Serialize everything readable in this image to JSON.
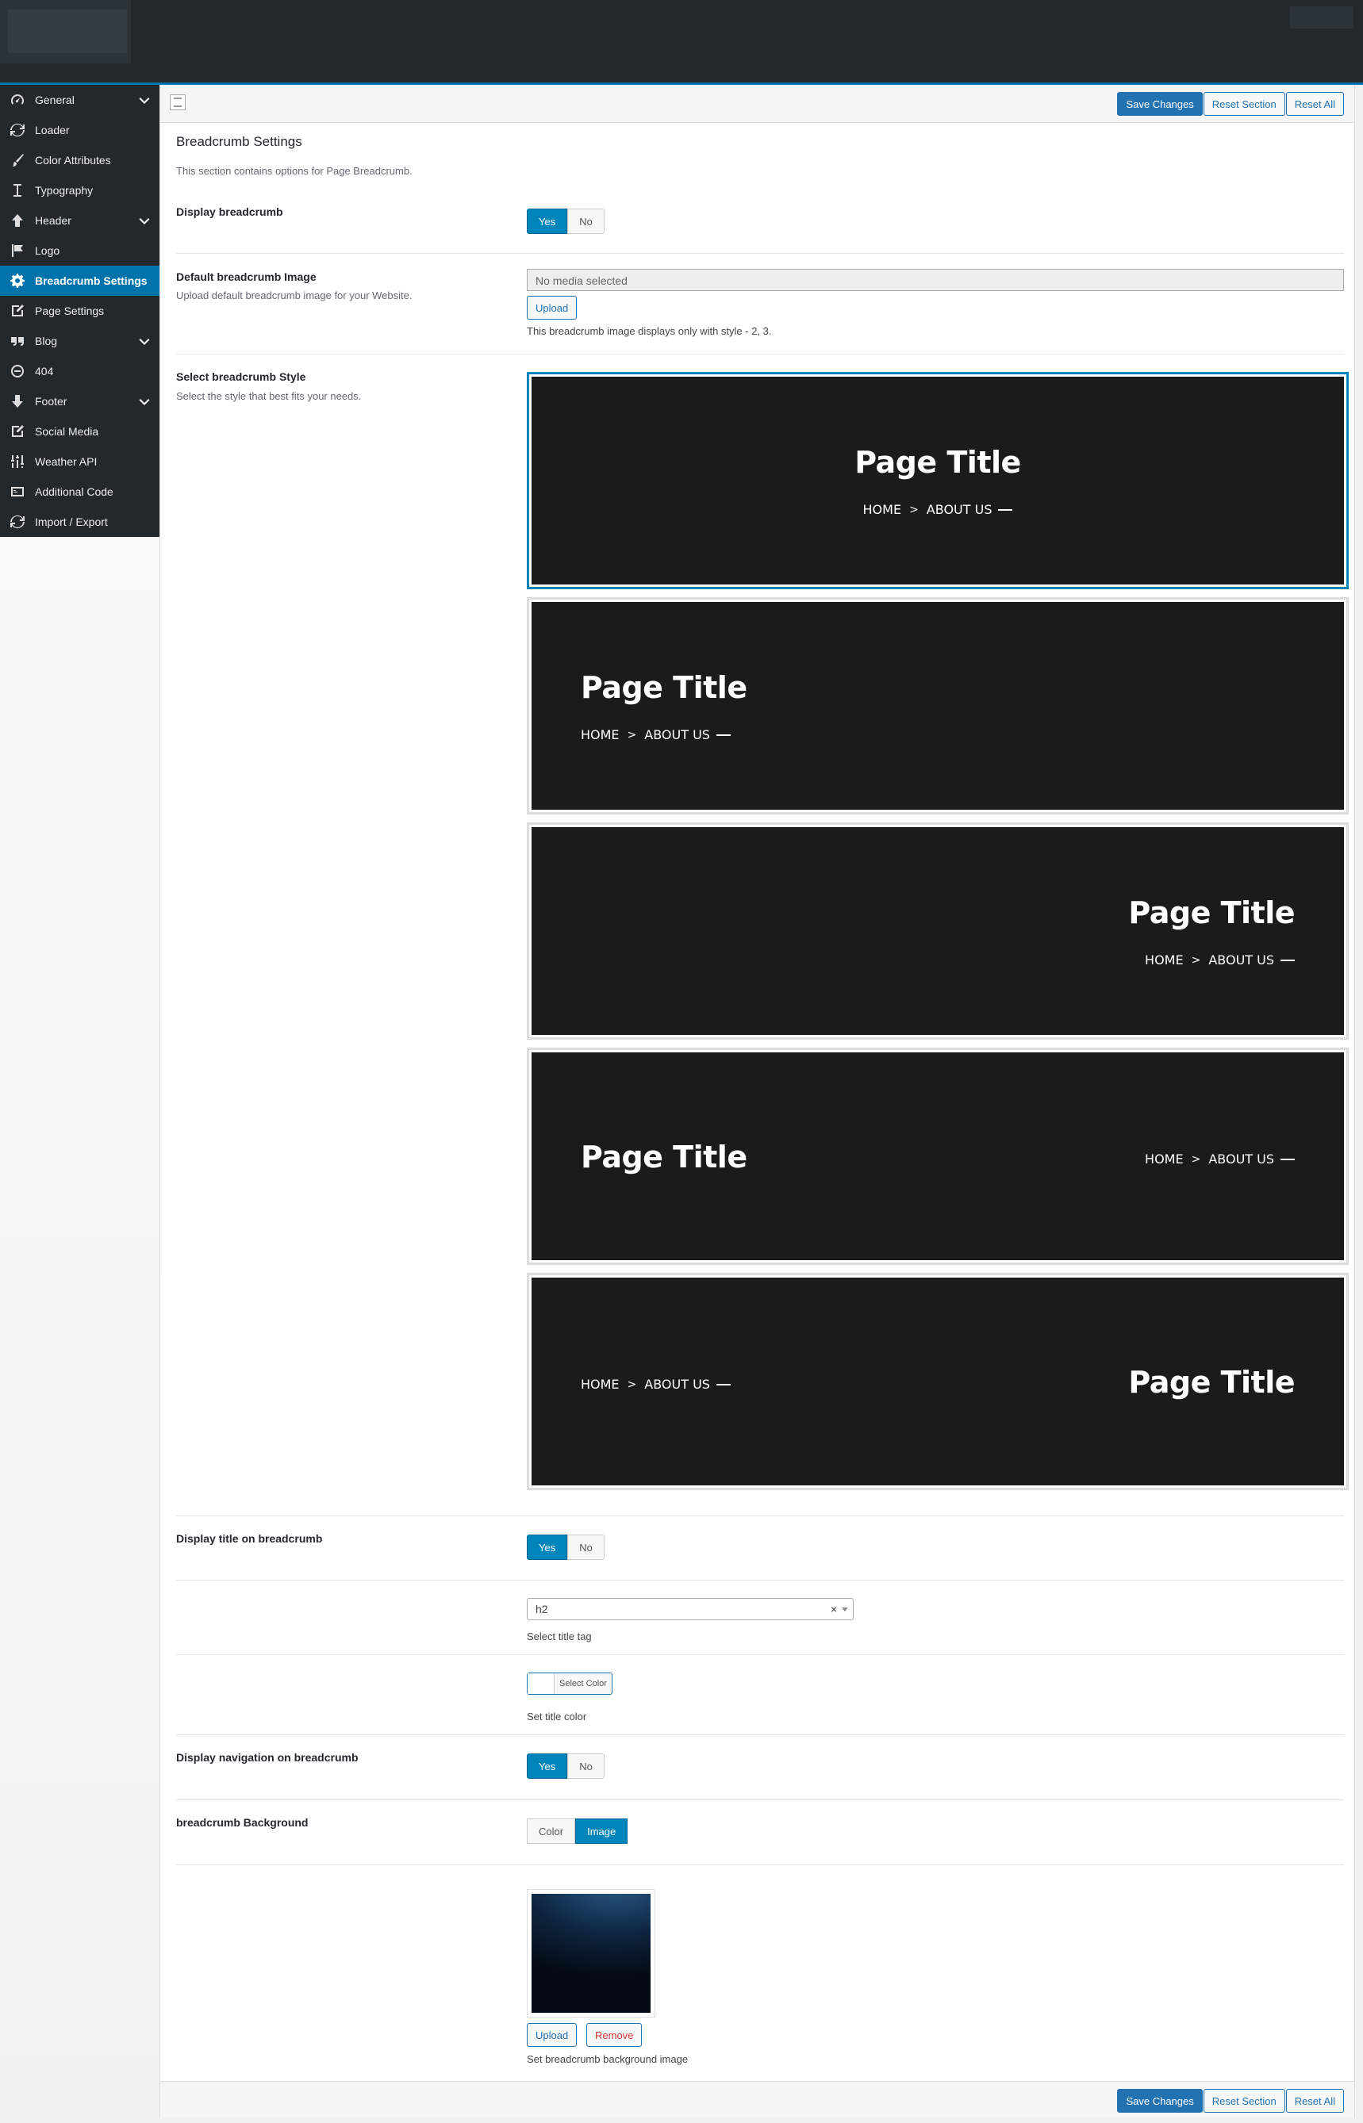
{
  "sidebar": {
    "items": [
      {
        "label": "General",
        "icon": "dashboard-gauge-icon",
        "has_children": true
      },
      {
        "label": "Loader",
        "icon": "refresh-icon",
        "has_children": false
      },
      {
        "label": "Color Attributes",
        "icon": "brush-icon",
        "has_children": false
      },
      {
        "label": "Typography",
        "icon": "text-cursor-icon",
        "has_children": false
      },
      {
        "label": "Header",
        "icon": "arrow-up-icon",
        "has_children": true
      },
      {
        "label": "Logo",
        "icon": "flag-icon",
        "has_children": false
      },
      {
        "label": "Breadcrumb Settings",
        "icon": "gear-icon",
        "has_children": false,
        "active": true
      },
      {
        "label": "Page Settings",
        "icon": "edit-icon",
        "has_children": false
      },
      {
        "label": "Blog",
        "icon": "quote-icon",
        "has_children": true
      },
      {
        "label": "404",
        "icon": "minus-circle-icon",
        "has_children": false
      },
      {
        "label": "Footer",
        "icon": "arrow-down-icon",
        "has_children": true
      },
      {
        "label": "Social Media",
        "icon": "share-edit-icon",
        "has_children": false
      },
      {
        "label": "Weather API",
        "icon": "sliders-icon",
        "has_children": false
      },
      {
        "label": "Additional Code",
        "icon": "code-icon",
        "has_children": false
      },
      {
        "label": "Import / Export",
        "icon": "refresh-icon",
        "has_children": false
      }
    ]
  },
  "toolbar": {
    "save": "Save Changes",
    "reset_section": "Reset Section",
    "reset_all": "Reset All"
  },
  "section": {
    "title": "Breadcrumb Settings",
    "description": "This section contains options for Page Breadcrumb."
  },
  "display_breadcrumb": {
    "label": "Display breadcrumb",
    "yes": "Yes",
    "no": "No",
    "value": "Yes"
  },
  "default_image": {
    "label": "Default breadcrumb Image",
    "sub": "Upload default breadcrumb image for your Website.",
    "placeholder": "No media selected",
    "upload": "Upload",
    "hint": "This breadcrumb image displays only with style - 2, 3."
  },
  "style": {
    "label": "Select breadcrumb Style",
    "sub": "Select the style that best fits your needs.",
    "page_title": "Page Title",
    "home": "HOME",
    "sep": ">",
    "about": "ABOUT US",
    "selected_index": 1
  },
  "display_title": {
    "label": "Display title on breadcrumb",
    "yes": "Yes",
    "no": "No",
    "value": "Yes"
  },
  "title_tag": {
    "value": "h2",
    "clear": "×",
    "hint": "Select title tag"
  },
  "title_color": {
    "button": "Select Color",
    "hint": "Set title color"
  },
  "display_nav": {
    "label": "Display navigation on breadcrumb",
    "yes": "Yes",
    "no": "No",
    "value": "Yes"
  },
  "bg": {
    "label": "breadcrumb Background",
    "color": "Color",
    "image": "Image",
    "value": "Image",
    "upload": "Upload",
    "remove": "Remove",
    "hint": "Set breadcrumb background image"
  },
  "colors": {
    "accent": "#0085ba",
    "sidebar_bg": "#23282d",
    "card_bg": "#1b1b1b"
  }
}
